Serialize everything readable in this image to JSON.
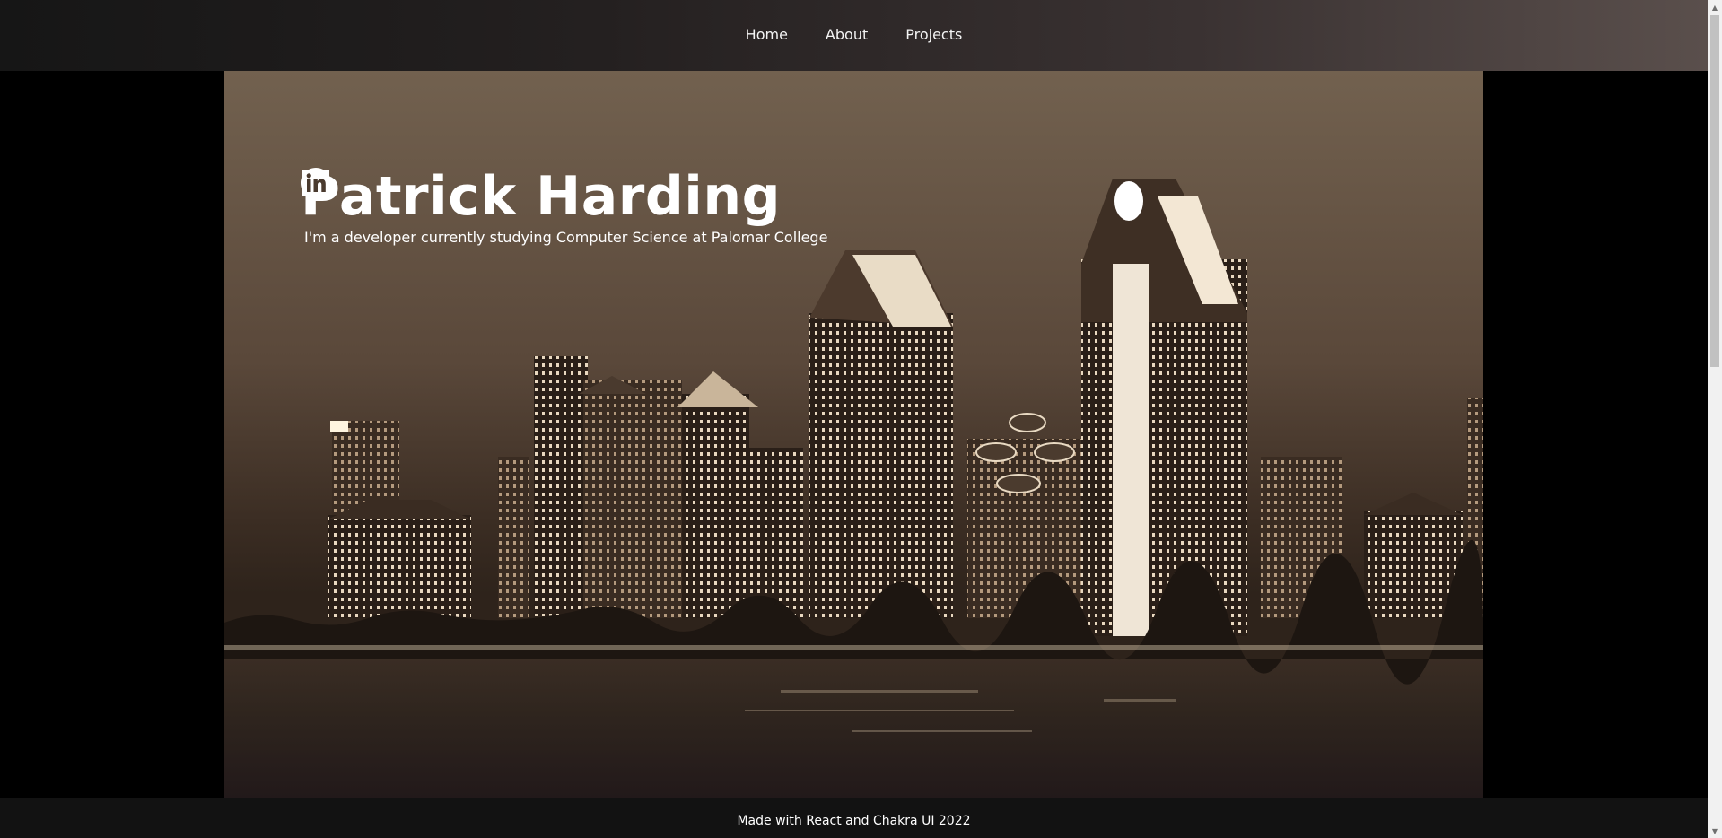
{
  "nav": {
    "items": [
      {
        "label": "Home"
      },
      {
        "label": "About"
      },
      {
        "label": "Projects"
      }
    ]
  },
  "hero": {
    "name": "Patrick Harding",
    "subtitle": "I'm a developer currently studying Computer Science at Palomar College",
    "social": [
      {
        "icon": "github-icon"
      },
      {
        "icon": "linkedin-icon"
      }
    ]
  },
  "footer": {
    "text": "Made with React and Chakra UI 2022"
  },
  "colors": {
    "nav_gradient_start": "#161616",
    "nav_gradient_end": "#5a4f4c",
    "footer_bg": "#121212",
    "text": "#ffffff"
  }
}
